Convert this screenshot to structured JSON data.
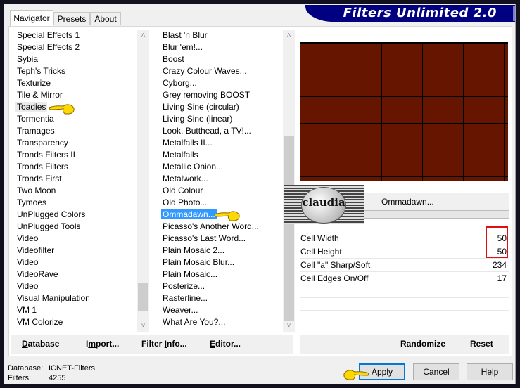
{
  "window": {
    "title": "Filters Unlimited 2.0"
  },
  "tabs": [
    {
      "label": "Navigator",
      "active": true
    },
    {
      "label": "Presets",
      "active": false
    },
    {
      "label": "About",
      "active": false
    }
  ],
  "categories": {
    "items": [
      "Special Effects 1",
      "Special Effects 2",
      "Sybia",
      "Teph's Tricks",
      "Texturize",
      "Tile & Mirror",
      "Toadies",
      "Tormentia",
      "Tramages",
      "Transparency",
      "Tronds Filters II",
      "Tronds Filters",
      "Tronds First",
      "Two Moon",
      "Tymoes",
      "UnPlugged Colors",
      "UnPlugged Tools",
      "Video",
      "Videofilter",
      "Video",
      "VideoRave",
      "Video",
      "Visual Manipulation",
      "VM 1",
      "VM Colorize"
    ],
    "selected": "Toadies"
  },
  "filters": {
    "items": [
      "Blast 'n Blur",
      "Blur 'em!...",
      "Boost",
      "Crazy Colour Waves...",
      "Cyborg...",
      "Grey removing BOOST",
      "Living Sine (circular)",
      "Living Sine (linear)",
      "Look, Butthead, a TV!...",
      "Metalfalls II...",
      "Metalfalls",
      "Metallic Onion...",
      "Metalwork...",
      "Old Colour",
      "Old Photo...",
      "Ommadawn...",
      "Picasso's Another Word...",
      "Picasso's Last Word...",
      "Plain Mosaic 2...",
      "Plain Mosaic Blur...",
      "Plain Mosaic...",
      "Posterize...",
      "Rasterline...",
      "Weaver...",
      "What Are You?..."
    ],
    "selected": "Ommadawn..."
  },
  "preview": {
    "fill_color": "#661600",
    "grid_color": "#000000"
  },
  "current_filter": "Ommadawn...",
  "logo_text": "claudia",
  "parameters": [
    {
      "label": "Cell Width",
      "value": "50"
    },
    {
      "label": "Cell Height",
      "value": "50"
    },
    {
      "label": "Cell \"a\" Sharp/Soft",
      "value": "234"
    },
    {
      "label": "Cell Edges On/Off",
      "value": "17"
    }
  ],
  "left_buttons": {
    "database": {
      "pre": "",
      "key": "D",
      "post": "atabase"
    },
    "import": {
      "pre": "I",
      "key": "m",
      "post": "port..."
    },
    "filter_info": {
      "pre": "Filter ",
      "key": "I",
      "post": "nfo..."
    },
    "editor": {
      "pre": "",
      "key": "E",
      "post": "ditor..."
    }
  },
  "right_buttons": {
    "randomize": "Randomize",
    "reset": "Reset"
  },
  "status": {
    "database_label": "Database:",
    "database_value": "ICNET-Filters",
    "filters_label": "Filters:",
    "filters_value": "4255"
  },
  "dialog_buttons": {
    "apply": "Apply",
    "cancel": "Cancel",
    "help": "Help"
  },
  "highlight_color": "#e01010",
  "accent_color": "#000080"
}
